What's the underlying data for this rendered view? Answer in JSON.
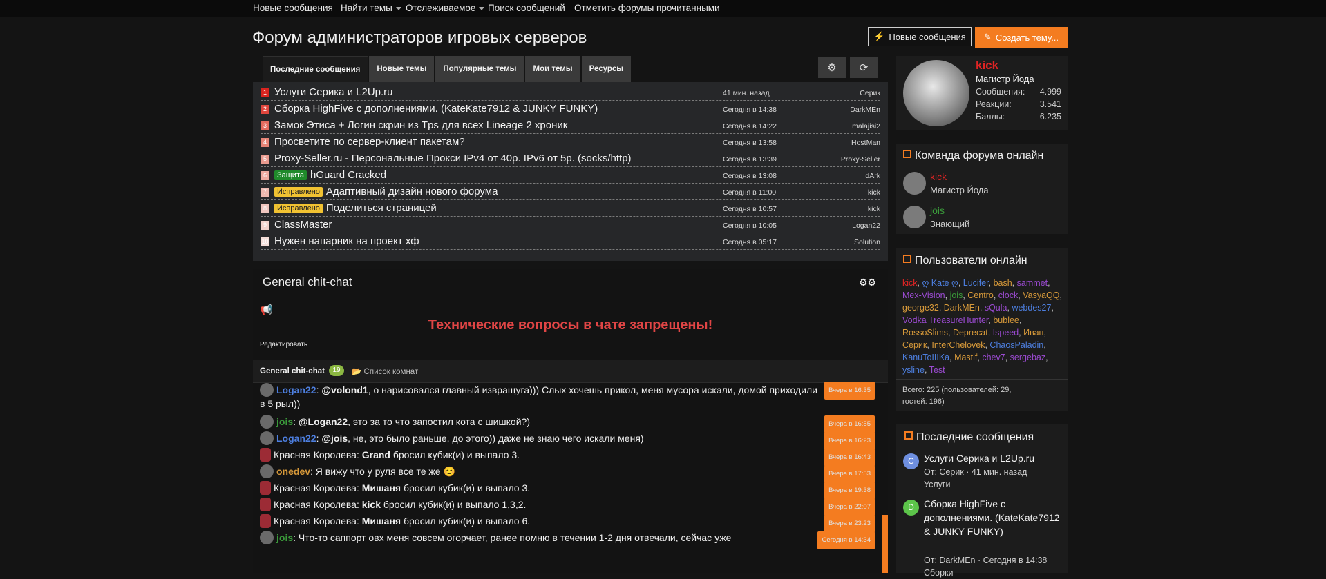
{
  "topnav": [
    "Новые сообщения",
    "Найти темы",
    "Отслеживаемое",
    "Поиск сообщений",
    "Отметить форумы прочитанными"
  ],
  "page_title": "Форум администраторов игровых серверов",
  "buttons": {
    "new_posts": "Новые сообщения",
    "create_thread": "Создать тему..."
  },
  "tabs": [
    "Последние сообщения",
    "Новые темы",
    "Популярные темы",
    "Мои темы",
    "Ресурсы"
  ],
  "threads": [
    {
      "num": "1",
      "prefix": "",
      "prefix_color": "",
      "title": "Услуги Серика и L2Up.ru",
      "time": "41 мин. назад",
      "author": "Серик",
      "num_color": "#d9241f"
    },
    {
      "num": "2",
      "prefix": "",
      "prefix_color": "",
      "title": "Сборка HighFive с дополнениями. (KateKate7912 & JUNKY FUNKY)",
      "time": "Сегодня в 14:38",
      "author": "DarkMEn",
      "num_color": "#e0463d"
    },
    {
      "num": "3",
      "prefix": "",
      "prefix_color": "",
      "title": "Замок Этиса + Логин скрин из Tps для всех Lineage 2 хроник",
      "time": "Сегодня в 14:22",
      "author": "malajisi2",
      "num_color": "#e36a5e"
    },
    {
      "num": "4",
      "prefix": "",
      "prefix_color": "",
      "title": "Просветите по сервер-клиент пакетам?",
      "time": "Сегодня в 13:58",
      "author": "HostMan",
      "num_color": "#e68476"
    },
    {
      "num": "5",
      "prefix": "",
      "prefix_color": "",
      "title": "Proxy-Seller.ru - Персональные Прокси IPv4 от 40р. IPv6 от 5р. (socks/http)",
      "time": "Сегодня в 13:39",
      "author": "Proxy-Seller",
      "num_color": "#e99a8e"
    },
    {
      "num": "6",
      "prefix": "Защита",
      "prefix_color": "#1f8a2a",
      "title": "hGuard Cracked",
      "time": "Сегодня в 13:08",
      "author": "dArk",
      "num_color": "#ecaaa0"
    },
    {
      "num": "7",
      "prefix": "Исправлено",
      "prefix_color": "#f1c232",
      "title": "Адаптивный дизайн нового форума",
      "time": "Сегодня в 11:00",
      "author": "kick",
      "num_color": "#eeb9b0"
    },
    {
      "num": "8",
      "prefix": "Исправлено",
      "prefix_color": "#f1c232",
      "title": "Поделиться страницей",
      "time": "Сегодня в 10:57",
      "author": "kick",
      "num_color": "#f0c6bf"
    },
    {
      "num": "9",
      "prefix": "",
      "prefix_color": "",
      "title": "ClassMaster",
      "time": "Сегодня в 10:05",
      "author": "Logan22",
      "num_color": "#f2d2cc"
    },
    {
      "num": "10",
      "prefix": "",
      "prefix_color": "",
      "title": "Нужен напарник на проект хф",
      "time": "Сегодня в 05:17",
      "author": "Solution",
      "num_color": "#f4ddd8"
    }
  ],
  "chat": {
    "title": "General chit-chat",
    "notice": "Технические вопросы в чате запрещены!",
    "edit": "Редактировать",
    "room_name": "General chit-chat",
    "room_count": "19",
    "room_list": "Список комнат",
    "messages": [
      {
        "user": "Logan22",
        "user_color": "#4d7fe0",
        "mention": "@volond1",
        "text": ", о нарисовался главный извращуга))) Слых хочешь прикол, меня мусора искали, домой приходили в 5 рыл))",
        "time": "Вчера в 16:35",
        "avatar": "default"
      },
      {
        "user": "jois",
        "user_color": "#3a9a3a",
        "mention": "@Logan22",
        "text": ", это за то что запостил кота с шишкой?)",
        "time": "Вчера в 16:55",
        "avatar": "default"
      },
      {
        "user": "Logan22",
        "user_color": "#4d7fe0",
        "mention": "@jois",
        "text": ", не, это было раньше, до этого)) даже не знаю чего искали меня)",
        "time": "Вчера в 16:23",
        "avatar": "default"
      },
      {
        "user": "Красная Королева",
        "user_color": "#eeeeee",
        "mention": "Grand",
        "text": " бросил кубик(и) и выпало 3.",
        "time": "Вчера в 16:43",
        "avatar": "queen"
      },
      {
        "user": "onedev",
        "user_color": "#d89a3a",
        "mention": "",
        "text": "Я вижу что у руля все те же 😊",
        "time": "Вчера в 17:53",
        "avatar": "default"
      },
      {
        "user": "Красная Королева",
        "user_color": "#eeeeee",
        "mention": "Мишаня",
        "text": " бросил кубик(и) и выпало 3.",
        "time": "Вчера в 19:38",
        "avatar": "queen"
      },
      {
        "user": "Красная Королева",
        "user_color": "#eeeeee",
        "mention": "kick",
        "text": " бросил кубик(и) и выпало 1,3,2.",
        "time": "Вчера в 22:07",
        "avatar": "queen"
      },
      {
        "user": "Красная Королева",
        "user_color": "#eeeeee",
        "mention": "Мишаня",
        "text": " бросил кубик(и) и выпало 6.",
        "time": "Вчера в 23:23",
        "avatar": "queen"
      },
      {
        "user": "jois",
        "user_color": "#3a9a3a",
        "mention": "",
        "text": "Что-то саппорт овх меня совсем огорчает, ранее помню в течении 1-2 дня отвечали, сейчас уже",
        "time": "Сегодня в 14:34",
        "avatar": "default"
      }
    ]
  },
  "profile": {
    "name": "kick",
    "title": "Магистр Йода",
    "stats": [
      {
        "label": "Сообщения:",
        "value": "4.999"
      },
      {
        "label": "Реакции:",
        "value": "3.541"
      },
      {
        "label": "Баллы:",
        "value": "6.235"
      }
    ]
  },
  "team": {
    "title": "Команда форума онлайн",
    "members": [
      {
        "name": "kick",
        "role": "Магистр Йода",
        "color": "#e02424"
      },
      {
        "name": "jois",
        "role": "Знающий",
        "color": "#3a9a3a"
      }
    ]
  },
  "users_online": {
    "title": "Пользователи онлайн",
    "users": [
      {
        "name": "kick",
        "color": "#e02424"
      },
      {
        "name": "ღ Kate ღ",
        "color": "#4d7fe0"
      },
      {
        "name": "Lucifer",
        "color": "#4d7fe0"
      },
      {
        "name": "bash",
        "color": "#d89a3a"
      },
      {
        "name": "sammet",
        "color": "#9a4ad0"
      },
      {
        "name": "Mex-Vision",
        "color": "#9a4ad0"
      },
      {
        "name": "jois",
        "color": "#3a9a3a"
      },
      {
        "name": "Centro",
        "color": "#d89a3a"
      },
      {
        "name": "clock",
        "color": "#9a4ad0"
      },
      {
        "name": "VasyaQQ",
        "color": "#d89a3a"
      },
      {
        "name": "george32",
        "color": "#d89a3a"
      },
      {
        "name": "DarkMEn",
        "color": "#d89a3a"
      },
      {
        "name": "sQula",
        "color": "#9a4ad0"
      },
      {
        "name": "webdes27",
        "color": "#4d7fe0"
      },
      {
        "name": "Vodka TreasureHunter",
        "color": "#9a4ad0"
      },
      {
        "name": "bublee",
        "color": "#d89a3a"
      },
      {
        "name": "RossoSlims",
        "color": "#d89a3a"
      },
      {
        "name": "Deprecat",
        "color": "#d89a3a"
      },
      {
        "name": "Ispeed",
        "color": "#9a4ad0"
      },
      {
        "name": "Иван",
        "color": "#d89a3a"
      },
      {
        "name": "Серик",
        "color": "#d89a3a"
      },
      {
        "name": "InterChelovek",
        "color": "#d89a3a"
      },
      {
        "name": "ChaosPaladin",
        "color": "#4d7fe0"
      },
      {
        "name": "KanuToIIIKa",
        "color": "#4d7fe0"
      },
      {
        "name": "Mastif",
        "color": "#d89a3a"
      },
      {
        "name": "chev7",
        "color": "#9a4ad0"
      },
      {
        "name": "sergebaz",
        "color": "#9a4ad0"
      },
      {
        "name": "ysline",
        "color": "#4d7fe0"
      },
      {
        "name": "Test",
        "color": "#9a4ad0"
      }
    ],
    "total_line1": "Всего: 225 (пользователей: 29,",
    "total_line2": "гостей: 196)"
  },
  "latest": {
    "title": "Последние сообщения",
    "posts": [
      {
        "letter": "С",
        "color": "#6e8fe0",
        "title": "Услуги Серика и L2Up.ru",
        "meta1": "От: Серик · 41 мин. назад",
        "meta2": "Услуги"
      },
      {
        "letter": "D",
        "color": "#5cc44a",
        "title": "Сборка HighFive с дополнениями. (KateKate7912 & JUNKY FUNKY)",
        "meta1": "От: DarkMEn · Сегодня в 14:38",
        "meta2": "Сборки"
      }
    ]
  },
  "colors": {
    "accent": "#f47c20",
    "danger": "#e04545",
    "panel": "#1c1c1c"
  }
}
